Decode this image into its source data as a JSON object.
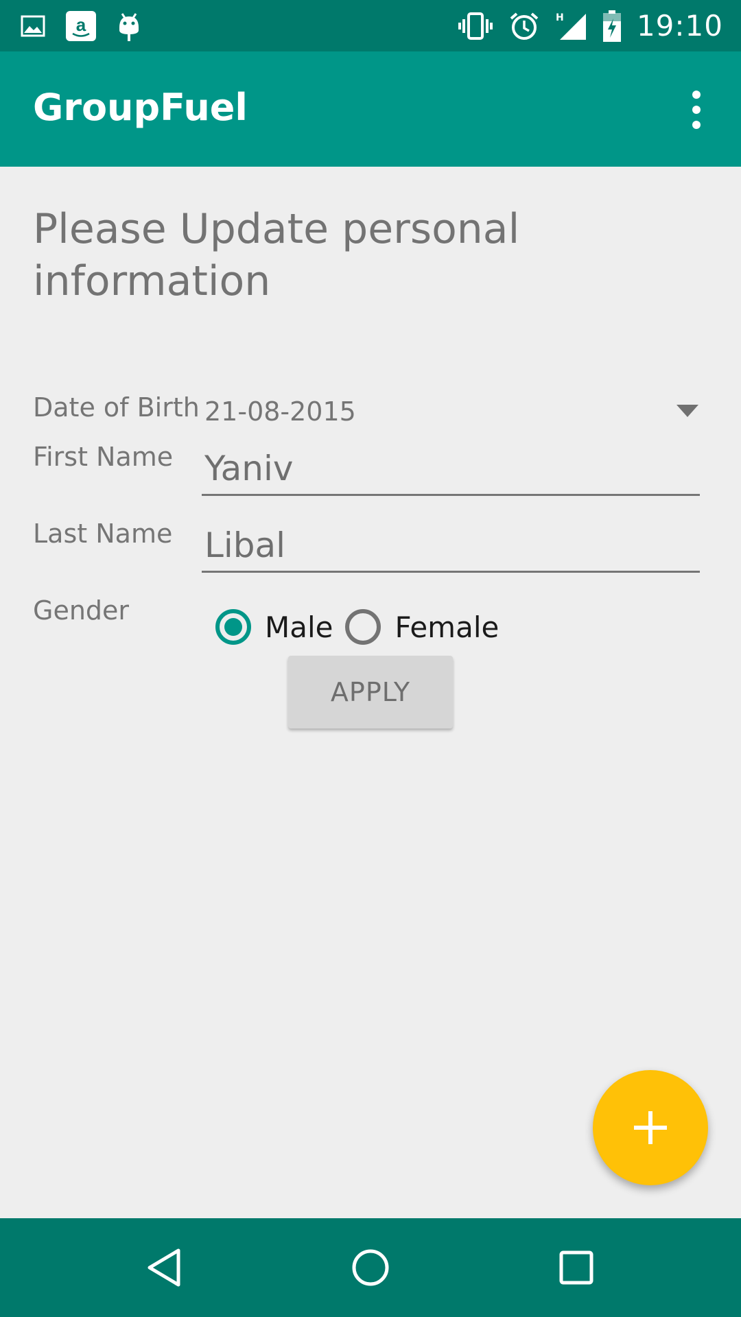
{
  "status_bar": {
    "time": "19:10",
    "left_icons": [
      "gallery-icon",
      "amazon-icon",
      "android-debug-icon"
    ],
    "right_icons": [
      "vibrate-icon",
      "alarm-icon",
      "signal-h-icon",
      "battery-charging-icon"
    ],
    "network_type": "H"
  },
  "app_bar": {
    "title": "GroupFuel",
    "menu_icon": "overflow-menu-icon"
  },
  "form": {
    "heading": "Please Update personal information",
    "dob_label": "Date of Birth",
    "dob_value": "21-08-2015",
    "first_name_label": "First Name",
    "first_name_value": "Yaniv",
    "last_name_label": "Last Name",
    "last_name_value": "Libal",
    "gender_label": "Gender",
    "gender_options": [
      {
        "label": "Male",
        "checked": true
      },
      {
        "label": "Female",
        "checked": false
      }
    ],
    "apply_label": "APPLY"
  },
  "fab": {
    "icon": "plus-icon"
  },
  "nav_bar": {
    "buttons": [
      "back-icon",
      "home-icon",
      "recents-icon"
    ]
  },
  "colors": {
    "status_bar": "#00796b",
    "app_bar": "#009688",
    "accent": "#009688",
    "fab": "#ffc107",
    "background": "#eeeeee"
  }
}
